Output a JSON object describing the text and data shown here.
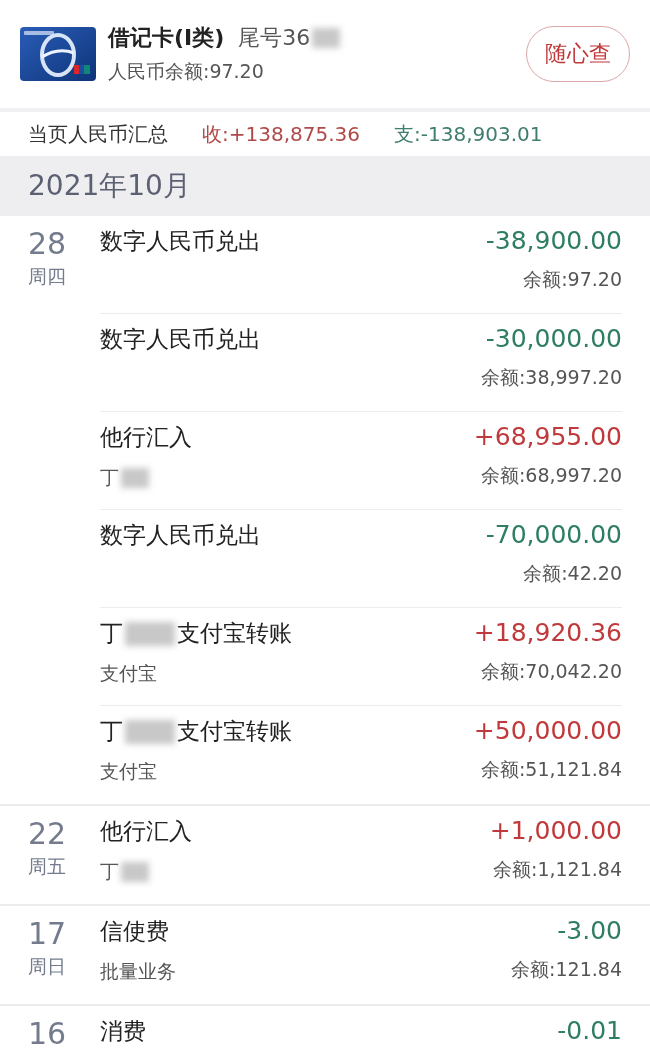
{
  "account": {
    "card_name": "借记卡(Ⅰ类)",
    "tail_label": "尾号36",
    "tail_masked": true,
    "balance": "人民币余额:97.20",
    "query_button": "随心查"
  },
  "summary": {
    "label": "当页人民币汇总",
    "income": "收:+138,875.36",
    "expense": "支:-138,903.01"
  },
  "month": "2021年10月",
  "days": [
    {
      "day": "28",
      "weekday": "周四",
      "transactions": [
        {
          "kind": "out",
          "title": "数字人民币兑出",
          "title_masked": false,
          "amount": "-38,900.00",
          "balance": "余额:97.20"
        },
        {
          "kind": "out",
          "title": "数字人民币兑出",
          "title_masked": false,
          "amount": "-30,000.00",
          "balance": "余额:38,997.20"
        },
        {
          "kind": "in",
          "title": "他行汇入",
          "title_masked": false,
          "counterpart": "丁",
          "counterpart_masked": true,
          "amount": "+68,955.00",
          "balance": "余额:68,997.20"
        },
        {
          "kind": "out",
          "title": "数字人民币兑出",
          "title_masked": false,
          "amount": "-70,000.00",
          "balance": "余额:42.20"
        },
        {
          "kind": "in",
          "title": "丁",
          "title_masked": true,
          "title_rest": "支付宝转账",
          "counterpart": "支付宝",
          "counterpart_masked": false,
          "amount": "+18,920.36",
          "balance": "余额:70,042.20"
        },
        {
          "kind": "in",
          "title": "丁",
          "title_masked": true,
          "title_rest": "支付宝转账",
          "counterpart": "支付宝",
          "counterpart_masked": false,
          "amount": "+50,000.00",
          "balance": "余额:51,121.84"
        }
      ]
    },
    {
      "day": "22",
      "weekday": "周五",
      "transactions": [
        {
          "kind": "in",
          "title": "他行汇入",
          "title_masked": false,
          "counterpart": "丁",
          "counterpart_masked": true,
          "amount": "+1,000.00",
          "balance": "余额:1,121.84"
        }
      ]
    },
    {
      "day": "17",
      "weekday": "周日",
      "transactions": [
        {
          "kind": "out",
          "title": "信使费",
          "title_masked": false,
          "counterpart": "批量业务",
          "counterpart_masked": false,
          "amount": "-3.00",
          "balance": "余额:121.84"
        }
      ]
    },
    {
      "day": "16",
      "transactions": [
        {
          "kind": "out",
          "title": "消费",
          "title_masked": false,
          "amount": "-0.01"
        }
      ]
    }
  ]
}
